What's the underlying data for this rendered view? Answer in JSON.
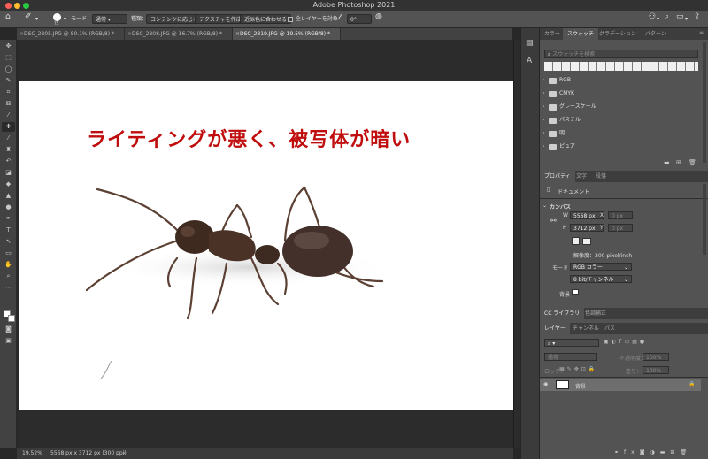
{
  "app_title": "Adobe Photoshop 2021",
  "options_bar": {
    "brush_size": "75",
    "mode_label": "モード：",
    "mode_value": "通常",
    "type_label": "種類：",
    "content_aware": "コンテンツに応じる",
    "texture": "テクスチャを作成",
    "proximity": "近似色に合わせる",
    "sample_all": "全レイヤーを対象",
    "angle": "0°"
  },
  "doc_tabs": [
    {
      "label": "DSC_2805.JPG @ 80.1% (RGB/8) *"
    },
    {
      "label": "DSC_2808.JPG @ 16.7% (RGB/8) *"
    },
    {
      "label": "DSC_2819.JPG @ 19.5% (RGB/8) *"
    }
  ],
  "headline": "ライティングが悪く、被写体が暗い",
  "status": {
    "zoom": "19.52%",
    "info": "5568 px x 3712 px (300 ppi)"
  },
  "swatches": {
    "tabs": [
      "カラー",
      "スウォッチ",
      "グラデーション",
      "パターン"
    ],
    "search_placeholder": "スウォッチを検索",
    "folders": [
      "RGB",
      "CMYK",
      "グレースケール",
      "パステル",
      "明",
      "ピュア"
    ]
  },
  "properties": {
    "tabs": [
      "プロパティ",
      "文字",
      "段落"
    ],
    "doc_label": "ドキュメント",
    "canvas_section": "カンバス",
    "w_label": "W",
    "w_value": "5568 px",
    "h_label": "H",
    "h_value": "3712 px",
    "x_label": "X",
    "x_value": "0 px",
    "y_label": "Y",
    "y_value": "0 px",
    "resolution": "解像度：300 pixel/inch",
    "mode_label": "モード",
    "mode_value": "RGB カラー",
    "depth_value": "8 bit/チャンネル",
    "bg_label": "背景"
  },
  "libraries": {
    "tabs": [
      "CC ライブラリ",
      "色調補正"
    ]
  },
  "layers": {
    "tabs": [
      "レイヤー",
      "チャンネル",
      "パス"
    ],
    "blend": "通常",
    "opacity_label": "不透明度：",
    "opacity_value": "100%",
    "lock_label": "ロック：",
    "fill_label": "塗り：",
    "fill_value": "100%",
    "layer_name": "背景"
  },
  "colors": {
    "headline": "#c00d0d",
    "tl_close": "#fe5f57",
    "tl_min": "#febc2e",
    "tl_max": "#28c840"
  }
}
